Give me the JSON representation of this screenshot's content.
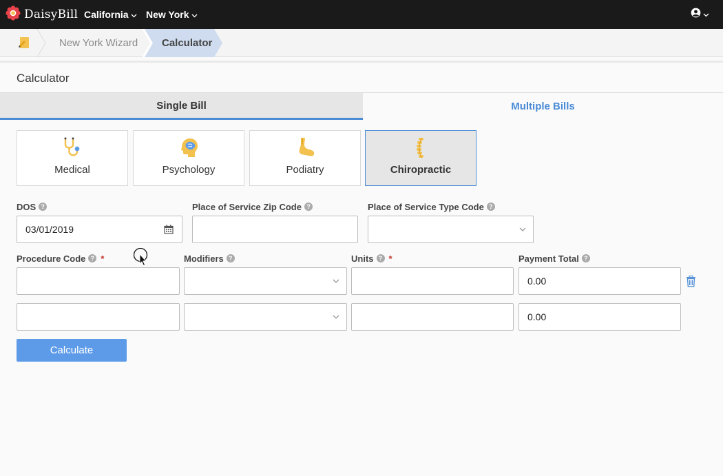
{
  "app": {
    "brand": "DaisyBill",
    "nav": [
      {
        "label": "California"
      },
      {
        "label": "New York"
      }
    ]
  },
  "breadcrumb": {
    "items": [
      "New York Wizard",
      "Calculator"
    ]
  },
  "page": {
    "title": "Calculator"
  },
  "tabs": {
    "single": "Single Bill",
    "multiple": "Multiple Bills",
    "active": "single"
  },
  "specialties": [
    {
      "label": "Medical",
      "icon": "stethoscope-icon"
    },
    {
      "label": "Psychology",
      "icon": "brain-icon"
    },
    {
      "label": "Podiatry",
      "icon": "foot-icon"
    },
    {
      "label": "Chiropractic",
      "icon": "spine-icon",
      "selected": true
    }
  ],
  "form": {
    "dos": {
      "label": "DOS",
      "value": "03/01/2019"
    },
    "zip": {
      "label": "Place of Service Zip Code",
      "value": ""
    },
    "type_code": {
      "label": "Place of Service Type Code",
      "value": ""
    },
    "columns": {
      "procedure": "Procedure Code",
      "modifiers": "Modifiers",
      "units": "Units",
      "payment": "Payment Total"
    },
    "rows": [
      {
        "procedure": "",
        "modifiers": "",
        "units": "",
        "payment": "0.00"
      },
      {
        "procedure": "",
        "modifiers": "",
        "units": "",
        "payment": "0.00"
      }
    ],
    "required_mark": "*",
    "help_mark": "?"
  },
  "actions": {
    "calculate": "Calculate"
  },
  "colors": {
    "accent": "#4a8bd6",
    "button": "#5d9be8",
    "topbar": "#1a1a1a",
    "required": "#c0392b",
    "icon_yellow": "#f2c14e"
  }
}
